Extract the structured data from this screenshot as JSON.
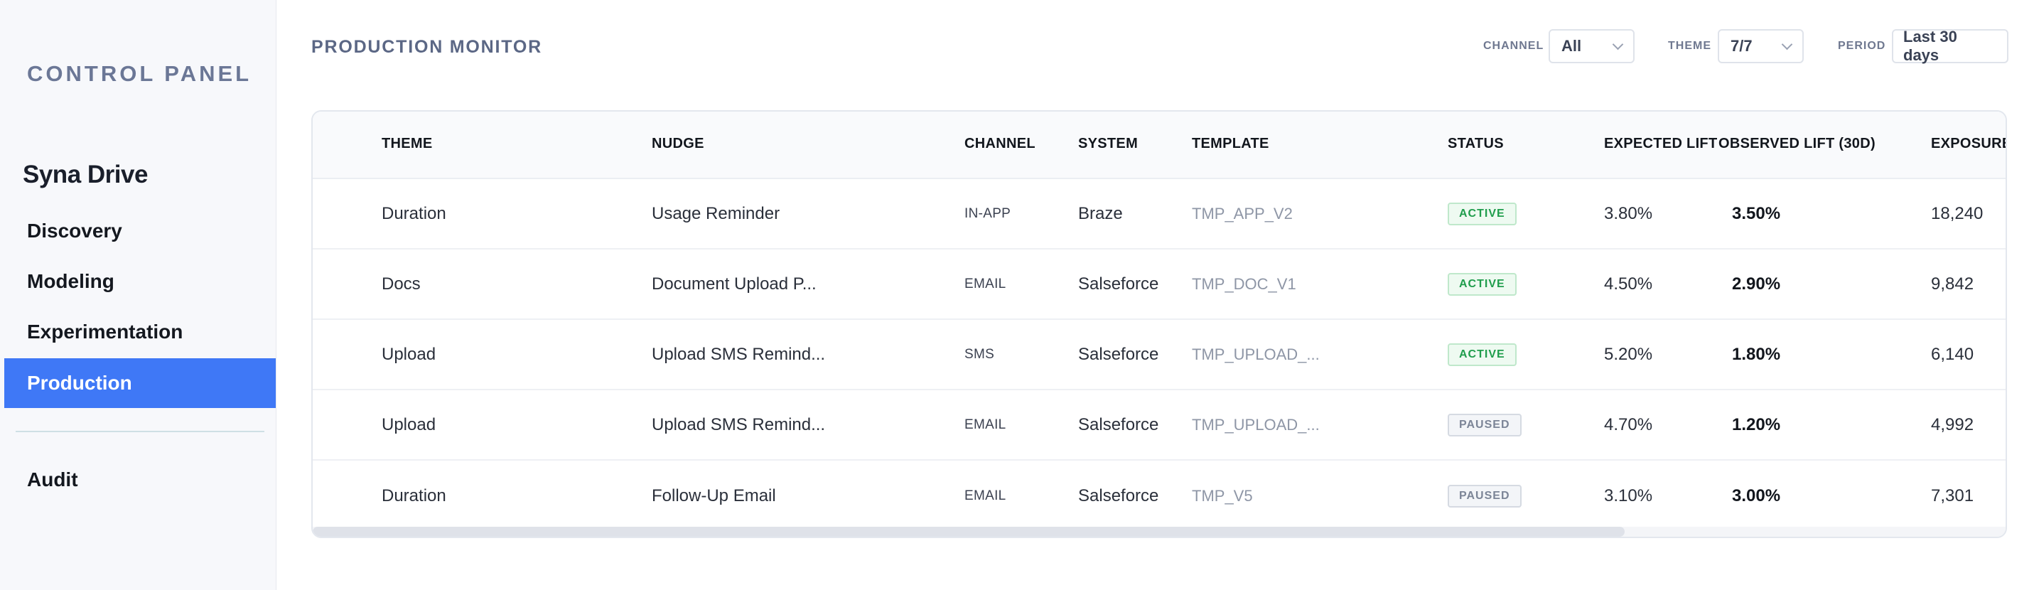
{
  "sidebar": {
    "brand": "CONTROL PANEL",
    "project": "Syna Drive",
    "items": [
      {
        "label": "Discovery",
        "active": false
      },
      {
        "label": "Modeling",
        "active": false
      },
      {
        "label": "Experimentation",
        "active": false
      },
      {
        "label": "Production",
        "active": true
      },
      {
        "label": "Audit",
        "active": false
      }
    ]
  },
  "header": {
    "title": "PRODUCTION MONITOR",
    "filters": {
      "channel": {
        "label": "CHANNEL",
        "value": "All"
      },
      "theme": {
        "label": "THEME",
        "value": "7/7"
      },
      "period": {
        "label": "PERIOD",
        "value": "Last 30 days"
      }
    }
  },
  "table": {
    "columns": [
      "THEME",
      "NUDGE",
      "CHANNEL",
      "SYSTEM",
      "TEMPLATE",
      "STATUS",
      "EXPECTED LIFT",
      "OBSERVED LIFT (30D)",
      "EXPOSURE"
    ],
    "rows": [
      {
        "theme": "Duration",
        "nudge": "Usage Reminder",
        "channel": "IN-APP",
        "system": "Braze",
        "template": "TMP_APP_V2",
        "status": "ACTIVE",
        "expected": "3.80%",
        "observed": "3.50%",
        "exposure": "18,240"
      },
      {
        "theme": "Docs",
        "nudge": "Document Upload P...",
        "channel": "EMAIL",
        "system": "Salseforce",
        "template": "TMP_DOC_V1",
        "status": "ACTIVE",
        "expected": "4.50%",
        "observed": "2.90%",
        "exposure": "9,842"
      },
      {
        "theme": "Upload",
        "nudge": "Upload SMS Remind...",
        "channel": "SMS",
        "system": "Salseforce",
        "template": "TMP_UPLOAD_...",
        "status": "ACTIVE",
        "expected": "5.20%",
        "observed": "1.80%",
        "exposure": "6,140"
      },
      {
        "theme": "Upload",
        "nudge": "Upload SMS Remind...",
        "channel": "EMAIL",
        "system": "Salseforce",
        "template": "TMP_UPLOAD_...",
        "status": "PAUSED",
        "expected": "4.70%",
        "observed": "1.20%",
        "exposure": "4,992"
      },
      {
        "theme": "Duration",
        "nudge": "Follow-Up Email",
        "channel": "EMAIL",
        "system": "Salseforce",
        "template": "TMP_V5",
        "status": "PAUSED",
        "expected": "3.10%",
        "observed": "3.00%",
        "exposure": "7,301"
      }
    ]
  },
  "colors": {
    "accent": "#3f78f6",
    "active_status": "#1f9d4c",
    "paused_status": "#7c8597"
  }
}
